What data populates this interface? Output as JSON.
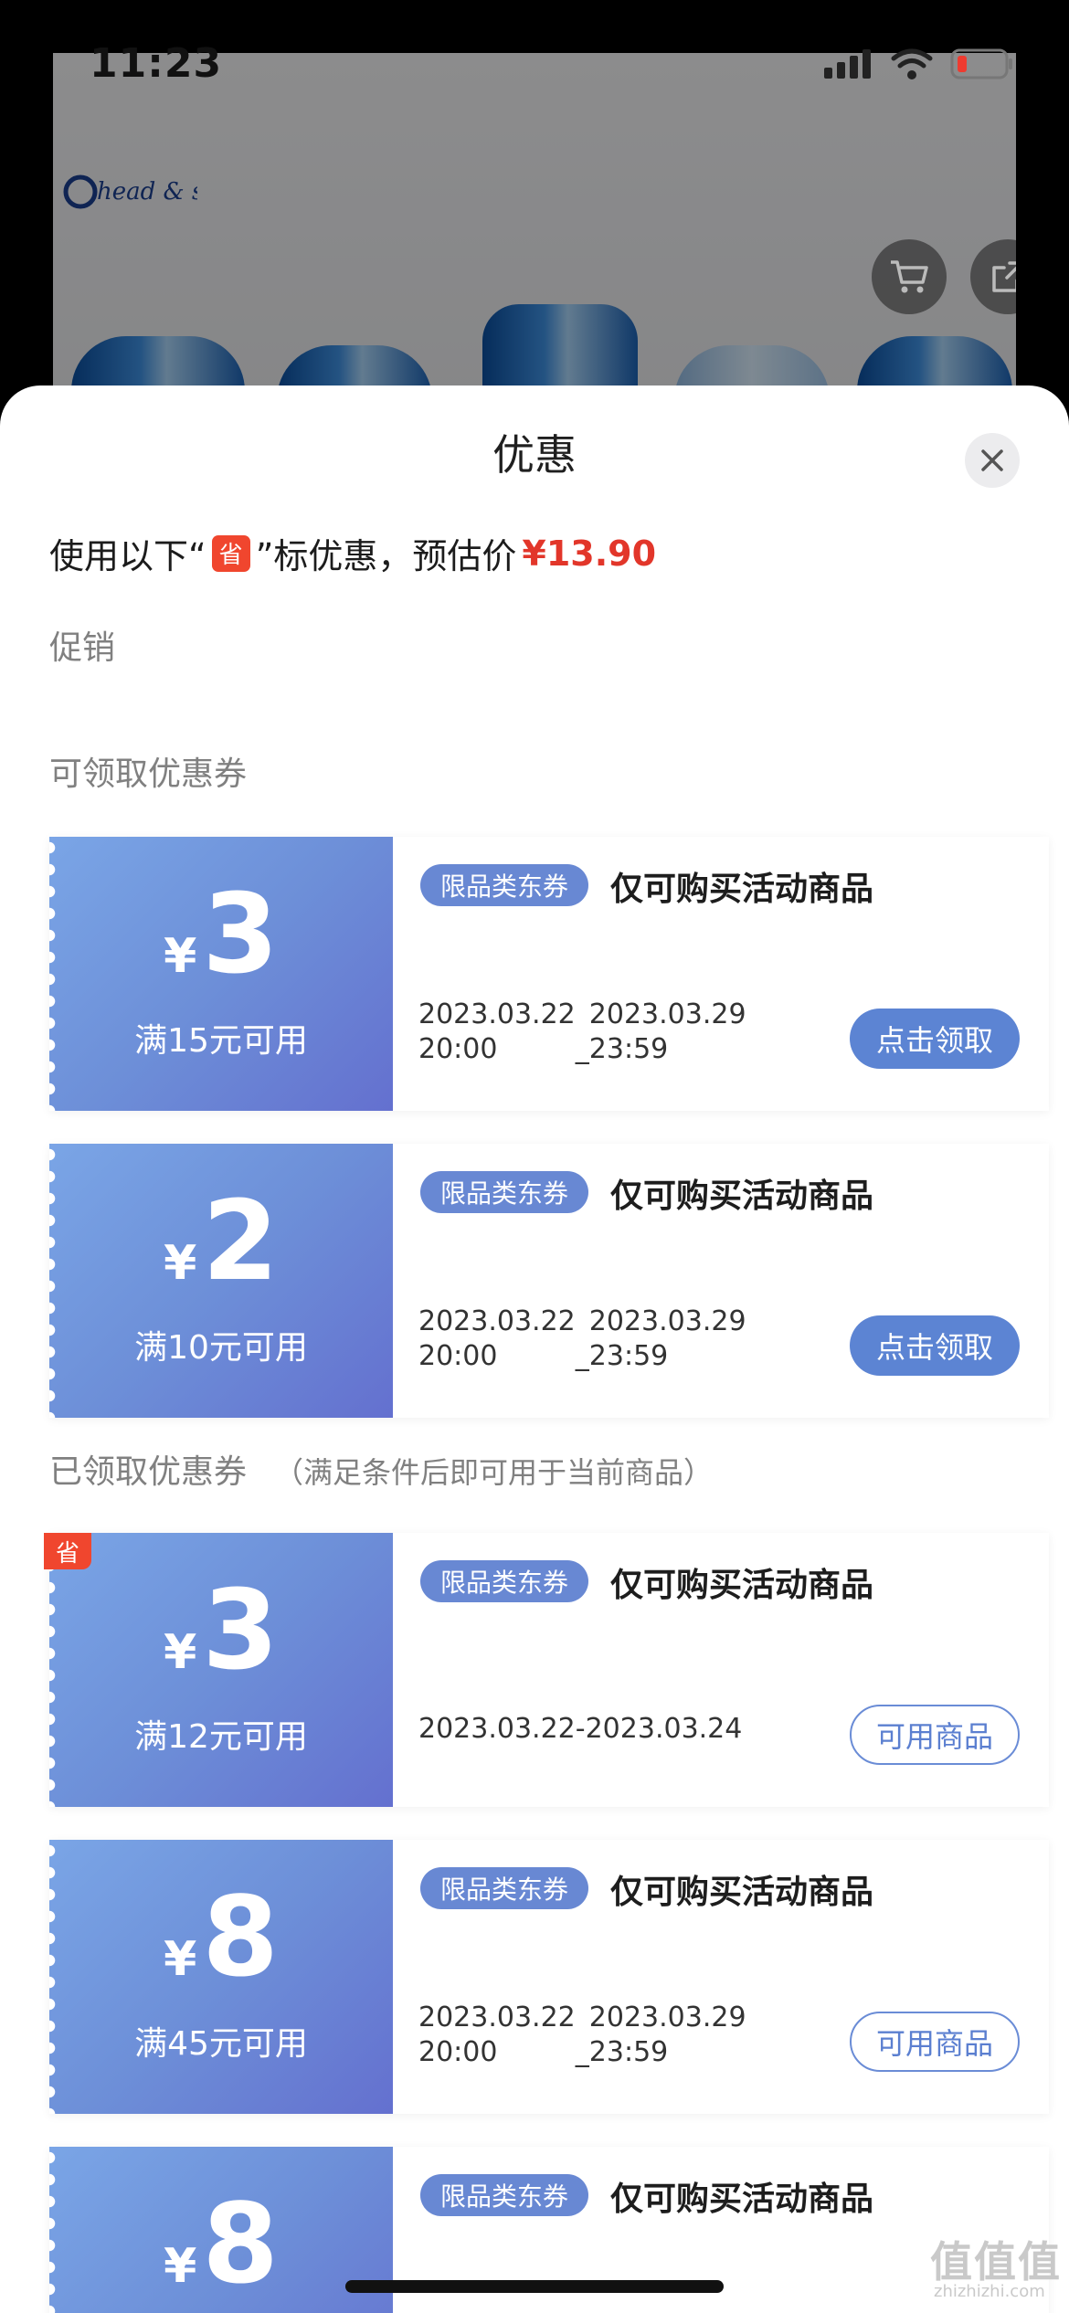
{
  "status_bar": {
    "time": "11:23"
  },
  "background_page": {
    "brand": "head & shoulders",
    "icons": [
      "cart-icon",
      "share-icon",
      "back-icon"
    ]
  },
  "sheet": {
    "title": "优惠",
    "estimate": {
      "prefix": "使用以下“",
      "badge": "省",
      "suffix": "”标优惠，预估价",
      "price": "¥13.90"
    },
    "sections": {
      "promo": "促销",
      "available": "可领取优惠券",
      "claimed": "已领取优惠券",
      "claimed_note": "（满足条件后即可用于当前商品）"
    },
    "coupons": [
      {
        "yen": "¥",
        "amount": "3",
        "condition": "满15元可用",
        "tag": "限品类东券",
        "desc": "仅可购买活动商品",
        "start_date": "2023.03.22",
        "start_time": "20:00",
        "end_date": "2023.03.29",
        "end_time": "23:59",
        "action": "点击领取"
      },
      {
        "yen": "¥",
        "amount": "2",
        "condition": "满10元可用",
        "tag": "限品类东券",
        "desc": "仅可购买活动商品",
        "start_date": "2023.03.22",
        "start_time": "20:00",
        "end_date": "2023.03.29",
        "end_time": "23:59",
        "action": "点击领取"
      },
      {
        "yen": "¥",
        "amount": "3",
        "condition": "满12元可用",
        "tag": "限品类东券",
        "desc": "仅可购买活动商品",
        "date_range": "2023.03.22-2023.03.24",
        "action": "可用商品",
        "flag": "省"
      },
      {
        "yen": "¥",
        "amount": "8",
        "condition": "满45元可用",
        "tag": "限品类东券",
        "desc": "仅可购买活动商品",
        "start_date": "2023.03.22",
        "start_time": "20:00",
        "end_date": "2023.03.29",
        "end_time": "23:59",
        "action": "可用商品"
      },
      {
        "yen": "¥",
        "amount": "8",
        "tag": "限品类东券",
        "desc": "仅可购买活动商品"
      }
    ]
  },
  "watermark": {
    "main": "值值值",
    "sub": "zhizhizhi.com"
  }
}
